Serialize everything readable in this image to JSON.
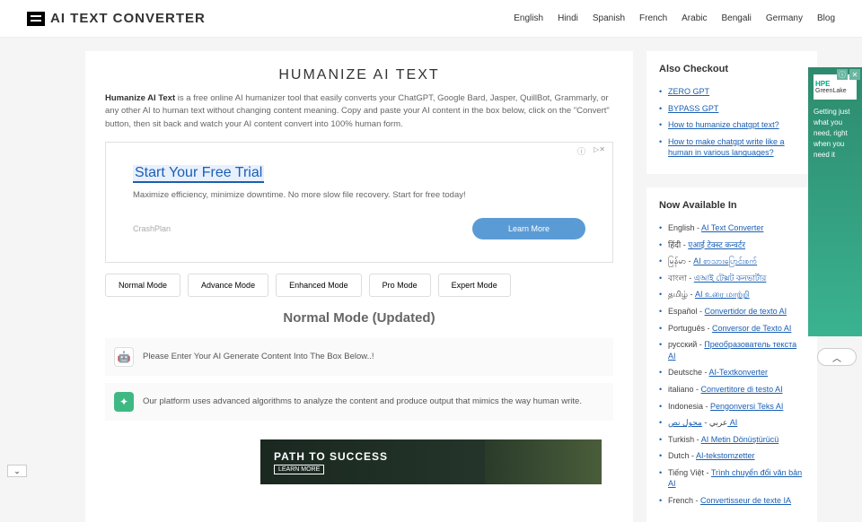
{
  "logo": "AI TEXT CONVERTER",
  "nav": [
    "English",
    "Hindi",
    "Spanish",
    "French",
    "Arabic",
    "Bengali",
    "Germany",
    "Blog"
  ],
  "main": {
    "title": "HUMANIZE AI TEXT",
    "desc_bold": "Humanize AI Text",
    "desc": " is a free online AI humanizer tool that easily converts your ChatGPT, Google Bard, Jasper, QuillBot, Grammarly, or any other AI to human text without changing content meaning. Copy and paste your AI content in the box below, click on the \"Convert\" button, then sit back and watch your AI content convert into 100% human form."
  },
  "ad1": {
    "title": "Start Your Free Trial",
    "desc": "Maximize efficiency, minimize downtime. No more slow file recovery. Start for free today!",
    "brand": "CrashPlan",
    "btn": "Learn More"
  },
  "modes": [
    "Normal Mode",
    "Advance Mode",
    "Enhanced Mode",
    "Pro Mode",
    "Expert Mode"
  ],
  "mode_title": "Normal Mode (Updated)",
  "info1": "Please Enter Your AI Generate Content Into The Box Below..!",
  "info2": "Our platform uses advanced algorithms to analyze the content and produce output that mimics the way human write.",
  "checkout": {
    "title": "Also Checkout",
    "items": [
      "ZERO GPT",
      "BYPASS GPT",
      "How to humanize chatgpt text?",
      "How to make chatgpt write like a human in various languages?"
    ]
  },
  "avail": {
    "title": "Now Available In",
    "items": [
      {
        "lang": "English",
        "link": "AI Text Converter"
      },
      {
        "lang": "हिंदी",
        "link": "एआई टेक्स्ट कन्वर्टर"
      },
      {
        "lang": "မြန်မာ",
        "link": "AI စာသားပြောင်းစက်"
      },
      {
        "lang": "বাংলা",
        "link": "এআই টেক্সট কনভার্টার"
      },
      {
        "lang": "தமிழ்",
        "link": "AI உரை மாற்றி"
      },
      {
        "lang": "Español",
        "link": "Convertidor de texto AI"
      },
      {
        "lang": "Português",
        "link": "Conversor de Texto AI"
      },
      {
        "lang": "русский",
        "link": "Преобразователь текста AI"
      },
      {
        "lang": "Deutsche",
        "link": "AI-Textkonverter"
      },
      {
        "lang": "italiano",
        "link": "Convertitore di testo AI"
      },
      {
        "lang": "Indonesia",
        "link": "Pengonversi Teks AI"
      },
      {
        "lang": "عربي",
        "link": "محول نص AI"
      },
      {
        "lang": "Turkish",
        "link": "AI Metin Dönüştürücü"
      },
      {
        "lang": "Dutch",
        "link": "AI-tekstomzetter"
      },
      {
        "lang": "Tiếng Việt",
        "link": "Trình chuyển đổi văn bản AI"
      },
      {
        "lang": "French",
        "link": "Convertisseur de texte IA"
      }
    ]
  },
  "side_ad": {
    "brand1": "HPE",
    "brand2": "GreenLake",
    "text": "Getting just what you need, right when you need it"
  },
  "bottom_ad": {
    "title": "PATH TO SUCCESS",
    "sub": "LEARN MORE"
  }
}
